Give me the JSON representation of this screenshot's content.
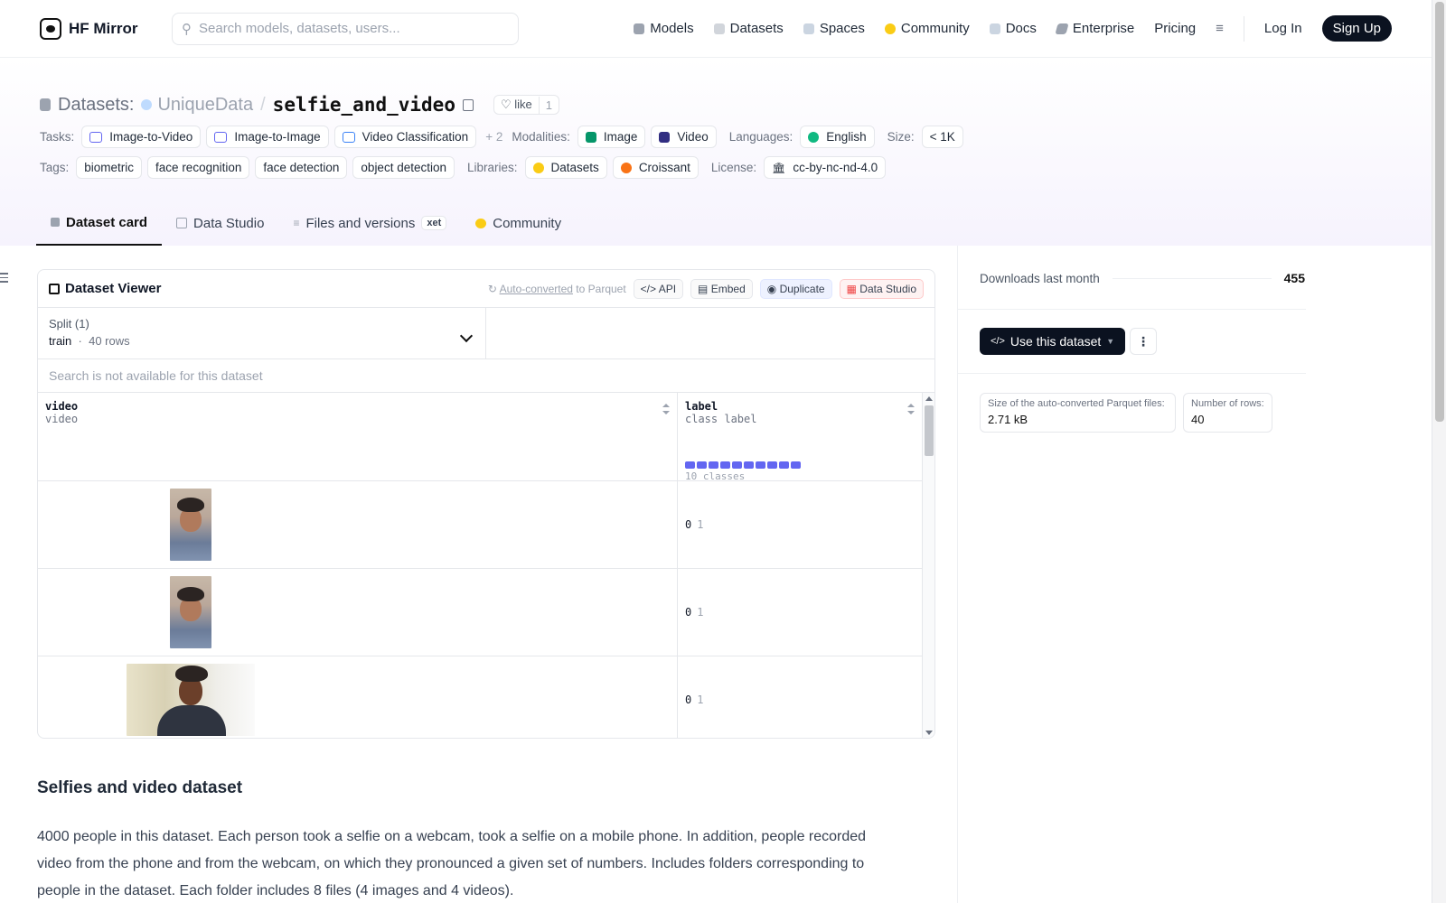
{
  "header": {
    "brand": "HF Mirror",
    "search_placeholder": "Search models, datasets, users...",
    "nav": [
      {
        "label": "Models",
        "icon": "cube-icon",
        "color": "#9ca3af"
      },
      {
        "label": "Datasets",
        "icon": "database-icon",
        "color": "#d1d5db"
      },
      {
        "label": "Spaces",
        "icon": "spaces-icon",
        "color": "#cbd5e1"
      },
      {
        "label": "Community",
        "icon": "community-icon",
        "color": "#facc15"
      },
      {
        "label": "Docs",
        "icon": "book-icon",
        "color": "#cbd5e1"
      },
      {
        "label": "Enterprise",
        "icon": "enterprise-icon",
        "color": "#9ca3af"
      },
      {
        "label": "Pricing"
      }
    ],
    "login": "Log In",
    "signup": "Sign Up"
  },
  "dataset": {
    "section": "Datasets:",
    "owner": "UniqueData",
    "separator": "/",
    "name": "selfie_and_video",
    "like_label": "like",
    "like_count": "1"
  },
  "meta": {
    "tasks_label": "Tasks:",
    "tasks": [
      "Image-to-Video",
      "Image-to-Image",
      "Video Classification"
    ],
    "tasks_more": "+ 2",
    "modalities_label": "Modalities:",
    "modalities": [
      "Image",
      "Video"
    ],
    "languages_label": "Languages:",
    "languages": [
      "English"
    ],
    "size_label": "Size:",
    "size": "< 1K",
    "tags_label": "Tags:",
    "tags": [
      "biometric",
      "face recognition",
      "face detection",
      "object detection"
    ],
    "libraries_label": "Libraries:",
    "libraries": [
      "Datasets",
      "Croissant"
    ],
    "license_label": "License:",
    "license": "cc-by-nc-nd-4.0"
  },
  "tabs": [
    {
      "label": "Dataset card",
      "active": true
    },
    {
      "label": "Data Studio"
    },
    {
      "label": "Files and versions",
      "badge": "xet"
    },
    {
      "label": "Community"
    }
  ],
  "viewer": {
    "title": "Dataset Viewer",
    "auto_converted": "Auto-converted",
    "to_parquet": "to Parquet",
    "buttons": [
      "API",
      "Embed",
      "Duplicate",
      "Data Studio"
    ],
    "split_label": "Split (1)",
    "split_value": "train",
    "split_rows": "40 rows",
    "search_disabled": "Search is not available for this dataset",
    "columns": [
      {
        "name": "video",
        "type": "video"
      },
      {
        "name": "label",
        "type": "class label",
        "summary": "10 classes"
      }
    ],
    "rows": [
      {
        "label_id": "0",
        "label_name": "1"
      },
      {
        "label_id": "0",
        "label_name": "1"
      },
      {
        "label_id": "0",
        "label_name": "1"
      }
    ]
  },
  "card": {
    "heading": "Selfies and video dataset",
    "body": "4000 people in this dataset. Each person took a selfie on a webcam, took a selfie on a mobile phone. In addition, people recorded video from the phone and from the webcam, on which they pronounced a given set of numbers. Includes folders corresponding to people in the dataset. Each folder includes 8 files (4 images and 4 videos)."
  },
  "sidebar": {
    "downloads_label": "Downloads last month",
    "downloads": "455",
    "use_button": "Use this dataset",
    "parquet_size_label": "Size of the auto-converted Parquet files:",
    "parquet_size": "2.71 kB",
    "rows_label": "Number of rows:",
    "rows": "40"
  }
}
